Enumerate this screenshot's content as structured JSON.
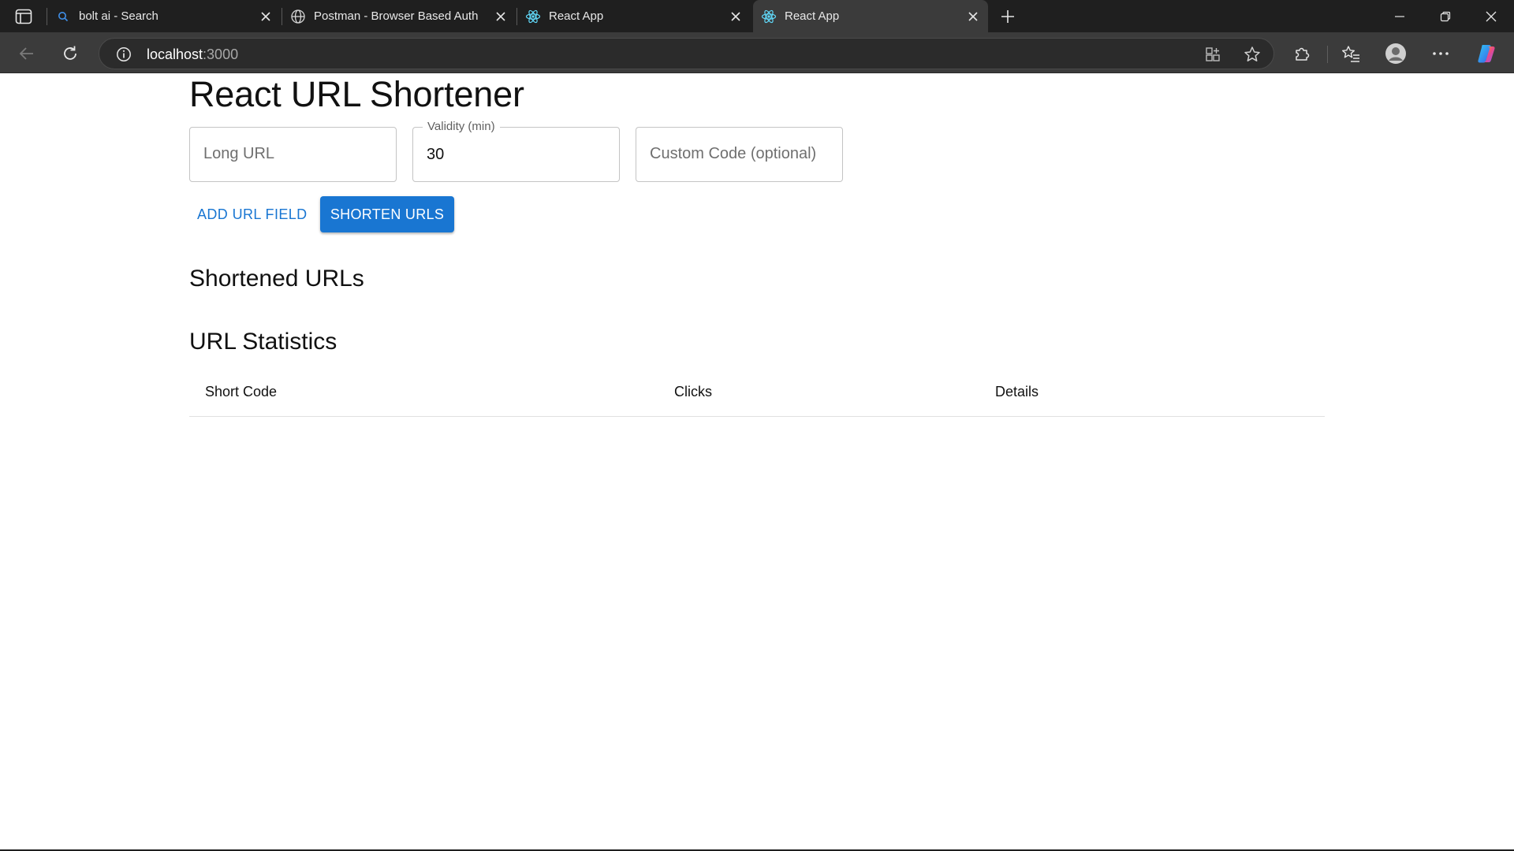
{
  "browser": {
    "tabs": [
      {
        "title": "bolt ai - Search",
        "icon": "search-icon",
        "active": false
      },
      {
        "title": "Postman - Browser Based Auth",
        "icon": "globe-icon",
        "active": false
      },
      {
        "title": "React App",
        "icon": "react-icon",
        "active": false
      },
      {
        "title": "React App",
        "icon": "react-icon",
        "active": true
      }
    ],
    "address": {
      "host": "localhost",
      "port": ":3000"
    }
  },
  "app": {
    "title": "React URL Shortener",
    "form": {
      "long_url_placeholder": "Long URL",
      "validity_label": "Validity (min)",
      "validity_value": "30",
      "custom_code_placeholder": "Custom Code (optional)"
    },
    "actions": {
      "add_field": "ADD URL FIELD",
      "shorten": "SHORTEN URLS"
    },
    "shortened_heading": "Shortened URLs",
    "stats": {
      "heading": "URL Statistics",
      "columns": [
        "Short Code",
        "Clicks",
        "Details"
      ]
    }
  },
  "colors": {
    "primary": "#1976d2",
    "tab_bar": "#1f1f1f",
    "toolbar": "#3b3b3b"
  }
}
